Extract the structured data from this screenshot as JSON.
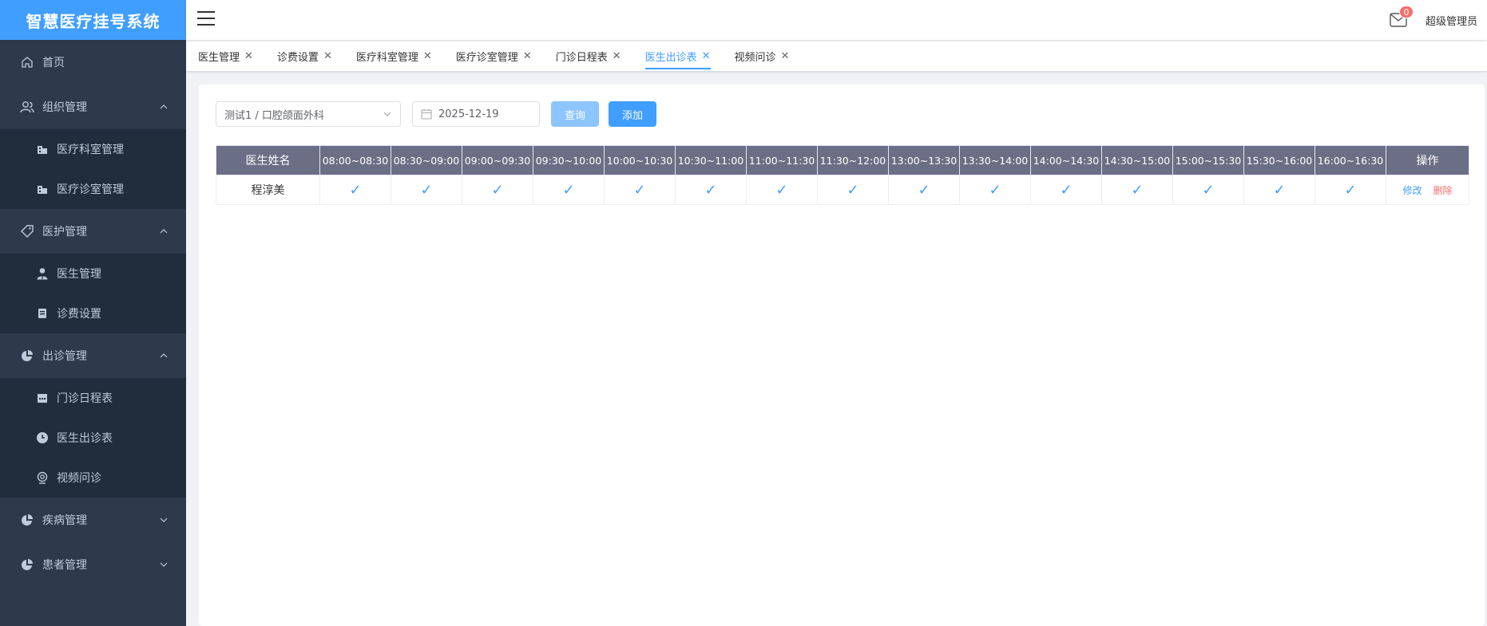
{
  "app": {
    "title": "智慧医疗挂号系统"
  },
  "sidebar": {
    "home": "首页",
    "groups": [
      {
        "label": "组织管理",
        "expanded": true,
        "items": [
          "医疗科室管理",
          "医疗诊室管理"
        ]
      },
      {
        "label": "医护管理",
        "expanded": true,
        "items": [
          "医生管理",
          "诊费设置"
        ]
      },
      {
        "label": "出诊管理",
        "expanded": true,
        "items": [
          "门诊日程表",
          "医生出诊表",
          "视频问诊"
        ]
      },
      {
        "label": "疾病管理",
        "expanded": false,
        "items": []
      },
      {
        "label": "患者管理",
        "expanded": false,
        "items": []
      }
    ]
  },
  "header": {
    "notification_count": "0",
    "username": "超级管理员"
  },
  "tags": [
    "医生管理",
    "诊费设置",
    "医疗科室管理",
    "医疗诊室管理",
    "门诊日程表",
    "医生出诊表",
    "视频问诊"
  ],
  "active_tag": "医生出诊表",
  "filters": {
    "department": "测试1 / 口腔颌面外科",
    "date": "2025-12-19",
    "query_label": "查询",
    "add_label": "添加"
  },
  "table": {
    "name_header": "医生姓名",
    "slots": [
      "08:00~08:30",
      "08:30~09:00",
      "09:00~09:30",
      "09:30~10:00",
      "10:00~10:30",
      "10:30~11:00",
      "11:00~11:30",
      "11:30~12:00",
      "13:00~13:30",
      "13:30~14:00",
      "14:00~14:30",
      "14:30~15:00",
      "15:00~15:30",
      "15:30~16:00",
      "16:00~16:30"
    ],
    "ops_header": "操作",
    "rows": [
      {
        "name": "程淳美",
        "checks": [
          true,
          true,
          true,
          true,
          true,
          true,
          true,
          true,
          true,
          true,
          true,
          true,
          true,
          true,
          true
        ],
        "edit": "修改",
        "delete": "删除"
      }
    ]
  },
  "colors": {
    "brand": "#409eff",
    "sidebar_bg": "#2d3a4b",
    "submenu_bg": "#1f2d3d",
    "table_header": "#6a6f86",
    "danger": "#f56c6c"
  }
}
